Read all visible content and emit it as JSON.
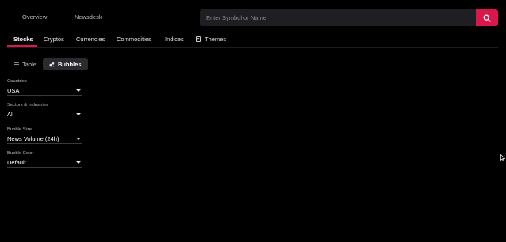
{
  "topnav": {
    "overview": "Overview",
    "newsdesk": "Newsdesk"
  },
  "search": {
    "placeholder": "Enter Symbol or Name",
    "button_icon": "search-icon",
    "accent": "#d9174b"
  },
  "tabs": [
    {
      "label": "Stocks",
      "active": true
    },
    {
      "label": "Cryptos"
    },
    {
      "label": "Currencies"
    },
    {
      "label": "Commodities"
    },
    {
      "label": "Indices"
    },
    {
      "label": "Themes",
      "icon": "themes-icon"
    }
  ],
  "view_toggle": {
    "table": {
      "label": "Table",
      "icon": "list-icon"
    },
    "bubbles": {
      "label": "Bubbles",
      "icon": "bubbles-icon",
      "active": true
    }
  },
  "filters": {
    "countries": {
      "label": "Countries",
      "value": "USA"
    },
    "sectors": {
      "label": "Sectors & Industries",
      "value": "All"
    },
    "bubble_size": {
      "label": "Bubble Size",
      "value": "News Volume (24h)"
    },
    "bubble_color": {
      "label": "Bubble Color",
      "value": "Default"
    }
  }
}
